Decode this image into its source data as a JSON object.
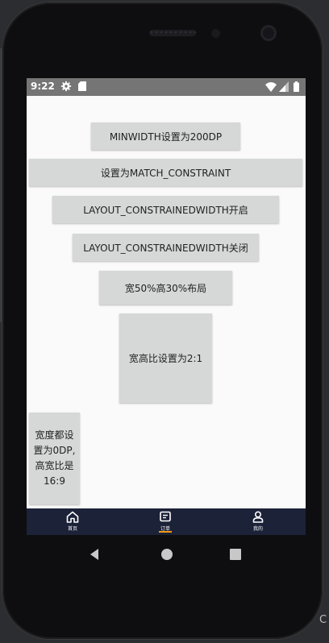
{
  "status_bar": {
    "time": "9:22",
    "icons": [
      "gear-icon",
      "sd-card-icon",
      "wifi-icon",
      "signal-icon",
      "battery-icon"
    ]
  },
  "buttons": {
    "minwidth": "MINWIDTH设置为200DP",
    "match_constraint": "设置为MATCH_CONSTRAINT",
    "constrained_on": "LAYOUT_CONSTRAINEDWIDTH开启",
    "constrained_off": "LAYOUT_CONSTRAINEDWIDTH关闭",
    "percent": "宽50%高30%布局",
    "ratio": "宽高比设置为2:1",
    "zero_dp": "宽度都设置为0DP,高宽比是16:9"
  },
  "bottom_nav": {
    "items": [
      {
        "label": "首页",
        "icon": "home-icon"
      },
      {
        "label": "订单",
        "icon": "order-icon",
        "selected": true
      },
      {
        "label": "我的",
        "icon": "user-icon"
      }
    ],
    "selected_color": "#f39c12"
  },
  "colors": {
    "status_bar": "#757575",
    "button_bg": "#d6d7d7",
    "nav_bg": "#1c2238",
    "screen_bg": "#fafafa"
  },
  "system_nav": [
    "back-icon",
    "home-circle-icon",
    "recents-icon"
  ]
}
